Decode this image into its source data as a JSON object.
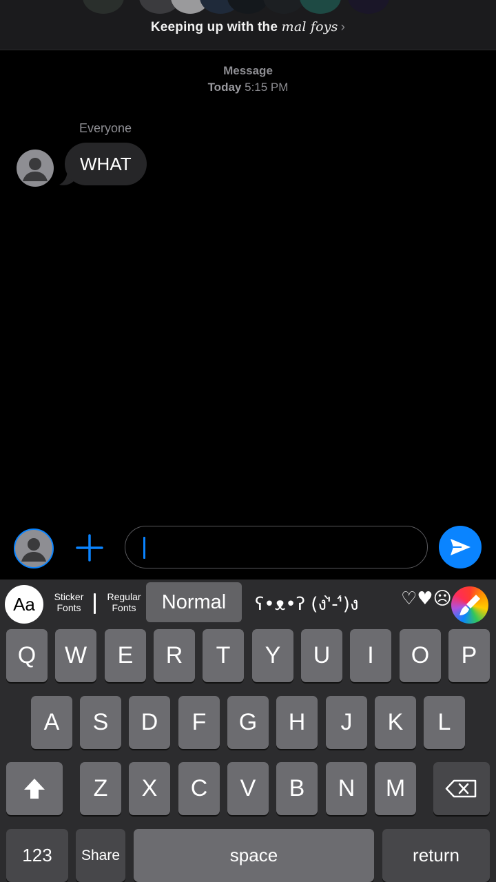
{
  "header": {
    "title_prefix": "Keeping up with the",
    "title_script": "mal foys",
    "chevron": "›"
  },
  "thread": {
    "timestamp_label": "Message",
    "timestamp_day": "Today",
    "timestamp_time": "5:15 PM",
    "sender": "Everyone",
    "message_text": "WHAT"
  },
  "compose": {
    "input_value": "",
    "send_icon": "send-arrow-icon",
    "plus_icon": "plus-icon"
  },
  "keyboard": {
    "toolbar": {
      "aa_label": "Aa",
      "sticker_fonts": [
        "Sticker",
        "Fonts"
      ],
      "regular_fonts": [
        "Regular",
        "Fonts"
      ],
      "normal_label": "Normal",
      "kaomoji": "ʕ•ᴥ•ʔ (ง'̀-'́)ง",
      "hearts": "♡♥☹"
    },
    "row1": [
      "Q",
      "W",
      "E",
      "R",
      "T",
      "Y",
      "U",
      "I",
      "O",
      "P"
    ],
    "row2": [
      "A",
      "S",
      "D",
      "F",
      "G",
      "H",
      "J",
      "K",
      "L"
    ],
    "row3": [
      "Z",
      "X",
      "C",
      "V",
      "B",
      "N",
      "M"
    ],
    "numbers_label": "123",
    "share_label": "Share",
    "space_label": "space",
    "return_label": "return"
  },
  "colors": {
    "accent": "#0a84ff",
    "background": "#000000",
    "keyboard_bg": "#2c2c2e",
    "key": "#6c6c70",
    "key_dark": "#47474a"
  }
}
